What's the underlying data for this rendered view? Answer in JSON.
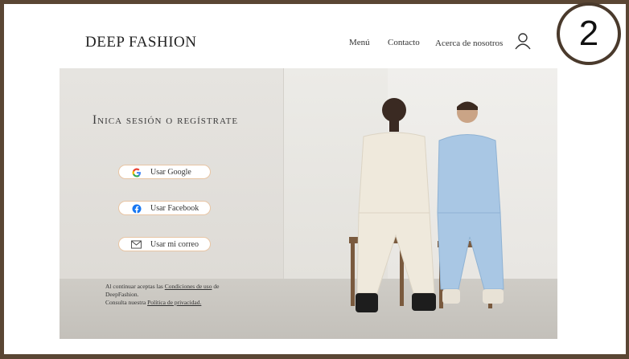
{
  "step_badge": "2",
  "header": {
    "brand": "DEEP FASHION",
    "nav": [
      "Menú",
      "Contacto",
      "Acerca de nosotros"
    ],
    "account_icon": "user-icon"
  },
  "hero": {
    "title": "Inica sesión o regístrate",
    "buttons": [
      {
        "label": "Usar Google",
        "icon": "google-icon"
      },
      {
        "label": "Usar Facebook",
        "icon": "facebook-icon"
      },
      {
        "label": "Usar mi correo",
        "icon": "mail-icon"
      }
    ],
    "legal": {
      "line1_prefix": "Al continuar aceptas las ",
      "terms_link": "Condiciones de uso",
      "line1_suffix": " de",
      "line2": "DeepFashion.",
      "line3_prefix": "Consulta nuestra ",
      "privacy_link": "Política de privacidad."
    }
  },
  "colors": {
    "frame": "#5a4634",
    "button_border": "#e8c5a4",
    "facebook": "#1877f2"
  }
}
